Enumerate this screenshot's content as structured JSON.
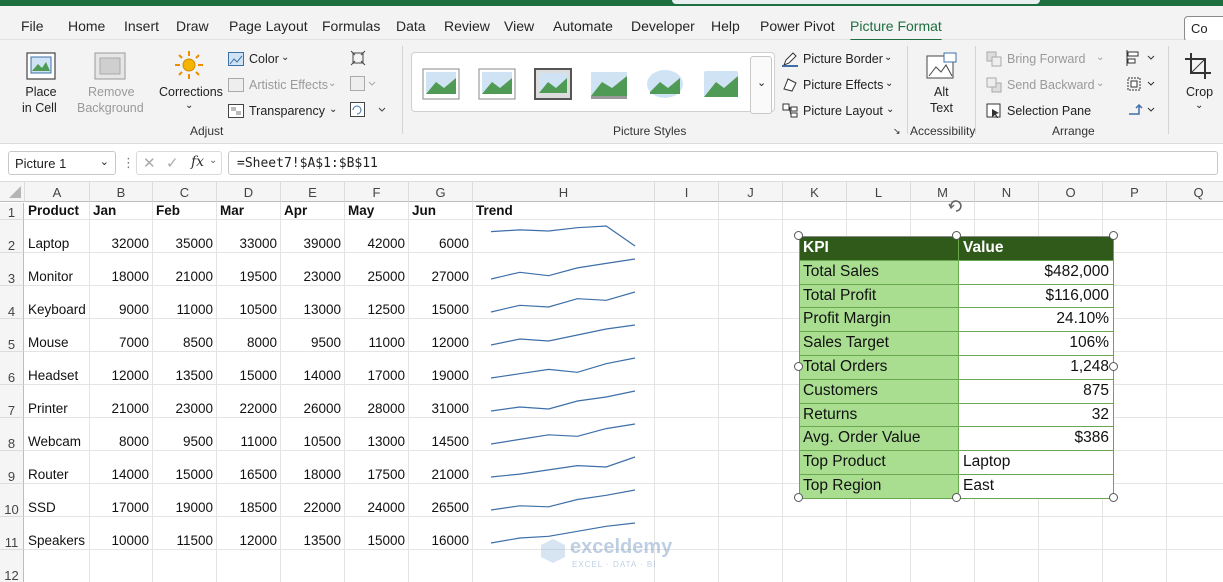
{
  "menu": {
    "tabs": [
      "File",
      "Home",
      "Insert",
      "Draw",
      "Page Layout",
      "Formulas",
      "Data",
      "Review",
      "View",
      "Automate",
      "Developer",
      "Help",
      "Power Pivot",
      "Picture Format"
    ],
    "active_tab": "Picture Format",
    "comment_stub": "Co"
  },
  "ribbon": {
    "place_in_cell": [
      "Place",
      "in Cell"
    ],
    "remove_background": [
      "Remove",
      "Background"
    ],
    "corrections": "Corrections",
    "color": "Color",
    "artistic_effects": "Artistic Effects",
    "transparency": "Transparency",
    "adjust_label": "Adjust",
    "picture_styles_label": "Picture Styles",
    "picture_border": "Picture Border",
    "picture_effects": "Picture Effects",
    "picture_layout": "Picture Layout",
    "alt_text": [
      "Alt",
      "Text"
    ],
    "accessibility_label": "Accessibility",
    "bring_forward": "Bring Forward",
    "send_backward": "Send Backward",
    "selection_pane": "Selection Pane",
    "arrange_label": "Arrange",
    "crop": "Crop"
  },
  "formula_bar": {
    "name_box": "Picture 1",
    "formula": "=Sheet7!$A$1:$B$11"
  },
  "sheet": {
    "columns": [
      "A",
      "B",
      "C",
      "D",
      "E",
      "F",
      "G",
      "H",
      "I",
      "J",
      "K",
      "L",
      "M",
      "N",
      "O",
      "P",
      "Q"
    ],
    "rows": [
      "1",
      "2",
      "3",
      "4",
      "5",
      "6",
      "7",
      "8",
      "9",
      "10",
      "11",
      "12"
    ],
    "headers": [
      "Product",
      "Jan",
      "Feb",
      "Mar",
      "Apr",
      "May",
      "Jun",
      "Trend"
    ],
    "data": [
      {
        "product": "Laptop",
        "values": [
          32000,
          35000,
          33000,
          39000,
          42000,
          6000
        ]
      },
      {
        "product": "Monitor",
        "values": [
          18000,
          21000,
          19500,
          23000,
          25000,
          27000
        ]
      },
      {
        "product": "Keyboard",
        "values": [
          9000,
          11000,
          10500,
          13000,
          12500,
          15000
        ]
      },
      {
        "product": "Mouse",
        "values": [
          7000,
          8500,
          8000,
          9500,
          11000,
          12000
        ]
      },
      {
        "product": "Headset",
        "values": [
          12000,
          13500,
          15000,
          14000,
          17000,
          19000
        ]
      },
      {
        "product": "Printer",
        "values": [
          21000,
          23000,
          22000,
          26000,
          28000,
          31000
        ]
      },
      {
        "product": "Webcam",
        "values": [
          8000,
          9500,
          11000,
          10500,
          13000,
          14500
        ]
      },
      {
        "product": "Router",
        "values": [
          14000,
          15000,
          16500,
          18000,
          17500,
          21000
        ]
      },
      {
        "product": "SSD",
        "values": [
          17000,
          19000,
          18500,
          22000,
          24000,
          26500
        ]
      },
      {
        "product": "Speakers",
        "values": [
          10000,
          11500,
          12000,
          13500,
          15000,
          16000
        ]
      }
    ],
    "sparkline_color": "#3d6fa8"
  },
  "kpi_picture": {
    "header": [
      "KPI",
      "Value"
    ],
    "rows": [
      {
        "k": "Total Sales",
        "v": "$482,000",
        "align": "r"
      },
      {
        "k": "Total Profit",
        "v": "$116,000",
        "align": "r"
      },
      {
        "k": "Profit Margin",
        "v": "24.10%",
        "align": "r"
      },
      {
        "k": "Sales Target",
        "v": "106%",
        "align": "r"
      },
      {
        "k": "Total Orders",
        "v": "1,248",
        "align": "r"
      },
      {
        "k": "Customers",
        "v": "875",
        "align": "r"
      },
      {
        "k": "Returns",
        "v": "32",
        "align": "r"
      },
      {
        "k": "Avg. Order Value",
        "v": "$386",
        "align": "r"
      },
      {
        "k": "Top Product",
        "v": "Laptop",
        "align": "l"
      },
      {
        "k": "Top Region",
        "v": "East",
        "align": "l"
      }
    ],
    "key_fill": "#a9de91",
    "header_fill": "#2f5a1a"
  },
  "watermark": {
    "name": "exceldemy",
    "tagline": "EXCEL · DATA · BI"
  }
}
